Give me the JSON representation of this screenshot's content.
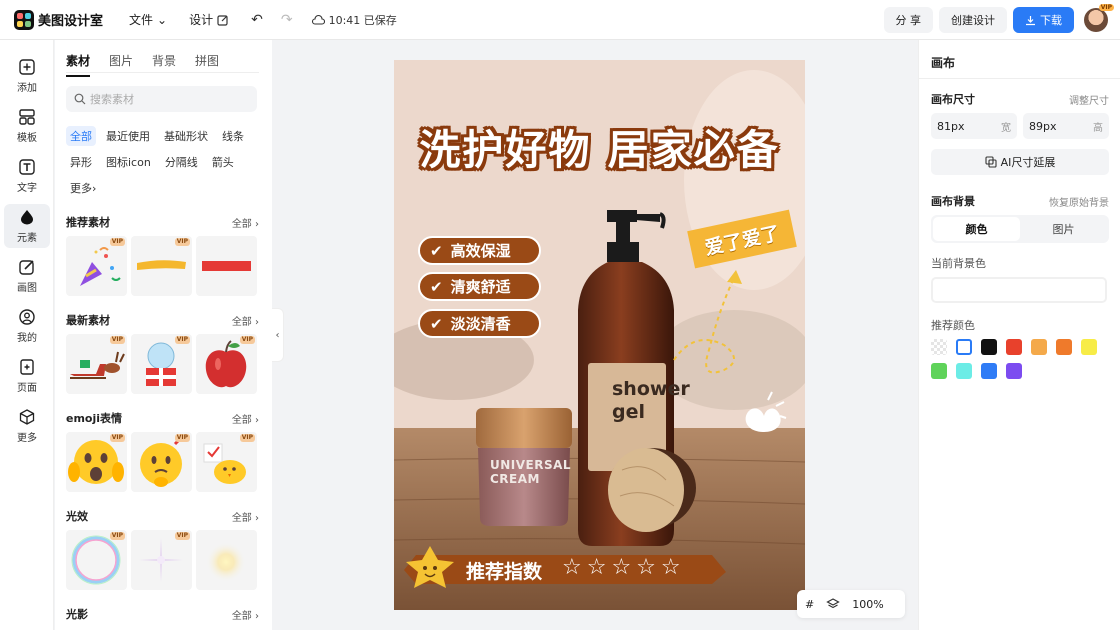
{
  "app": {
    "name": "美图设计室"
  },
  "toolbar": {
    "file_menu": "文件",
    "design_menu": "设计",
    "saved_status": "10:41 已保存",
    "share_label": "分 享",
    "create_label": "创建设计",
    "download_label": "下载",
    "avatar_badge": "VIP"
  },
  "leftnav": [
    {
      "label": "添加",
      "icon": "plus-square-icon"
    },
    {
      "label": "模板",
      "icon": "template-icon"
    },
    {
      "label": "文字",
      "icon": "text-icon"
    },
    {
      "label": "元素",
      "icon": "elements-icon",
      "active": true
    },
    {
      "label": "画图",
      "icon": "draw-icon"
    },
    {
      "label": "我的",
      "icon": "user-icon"
    },
    {
      "label": "页面",
      "icon": "page-add-icon"
    },
    {
      "label": "更多",
      "icon": "cube-icon"
    }
  ],
  "panel": {
    "tabs": [
      "素材",
      "图片",
      "背景",
      "拼图"
    ],
    "search_placeholder": "搜索素材",
    "chips": [
      "全部",
      "最近使用",
      "基础形状",
      "线条",
      "异形",
      "图标icon",
      "分隔线",
      "箭头",
      "更多"
    ],
    "all_label": "全部",
    "vip": "VIP",
    "sections": [
      {
        "title": "推荐素材",
        "items": [
          "party-popper",
          "yellow-brush-stroke",
          "red-bar"
        ]
      },
      {
        "title": "最新素材",
        "items": [
          "reindeer-sleigh",
          "snowglobe-gift",
          "red-apple"
        ]
      },
      {
        "title": "emoji表情",
        "items": [
          "shocked-emoji",
          "thinking-emoji",
          "chick-emoji"
        ]
      },
      {
        "title": "光效",
        "items": [
          "bubble-ring",
          "sparkle-cross",
          "glow-light"
        ]
      },
      {
        "title": "光影"
      }
    ]
  },
  "poster": {
    "headline": "洗护好物  居家必备",
    "features": [
      "高效保湿",
      "清爽舒适",
      "淡淡清香"
    ],
    "tag": "爱了爱了",
    "bottle_label_1": "shower",
    "bottle_label_2": "gel",
    "jar_label_1": "UNIVERSAL",
    "jar_label_2": "CREAM",
    "rating_label": "推荐指数",
    "stars": "☆☆☆☆☆",
    "rating_count": 5
  },
  "zoom": {
    "value": "100%"
  },
  "right": {
    "title": "画布",
    "size_label": "画布尺寸",
    "adjust_label": "调整尺寸",
    "width_value": "81px",
    "width_unit": "宽",
    "height_value": "89px",
    "height_unit": "高",
    "ai_expand": "AI尺寸延展",
    "bg_label": "画布背景",
    "restore_label": "恢复原始背景",
    "seg_color": "颜色",
    "seg_image": "图片",
    "current_color_label": "当前背景色",
    "recommend_label": "推荐颜色",
    "swatches": [
      "transparent",
      "#ffffff",
      "#111111",
      "#e8412c",
      "#f4a94a",
      "#ef7a2b",
      "#f7ec47",
      "#5fd35a",
      "#6cece6",
      "#2f7cf6",
      "#7c4cf0"
    ]
  }
}
